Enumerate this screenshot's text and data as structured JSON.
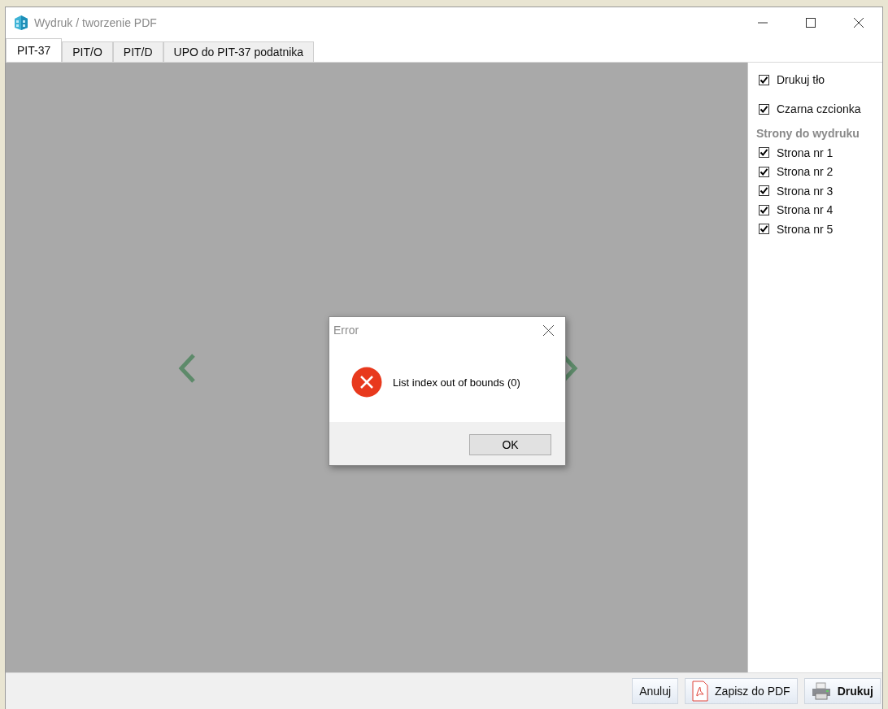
{
  "window": {
    "title": "Wydruk / tworzenie PDF"
  },
  "tabs": [
    {
      "label": "PIT-37",
      "selected": true
    },
    {
      "label": "PIT/O",
      "selected": false
    },
    {
      "label": "PIT/D",
      "selected": false
    },
    {
      "label": "UPO do PIT-37 podatnika",
      "selected": false
    }
  ],
  "options": [
    {
      "label": "Drukuj tło",
      "checked": true
    },
    {
      "label": "Czarna czcionka",
      "checked": true
    }
  ],
  "pages_section": {
    "heading": "Strony do wydruku",
    "pages": [
      {
        "label": "Strona nr 1",
        "checked": true
      },
      {
        "label": "Strona nr 2",
        "checked": true
      },
      {
        "label": "Strona nr 3",
        "checked": true
      },
      {
        "label": "Strona nr 4",
        "checked": true
      },
      {
        "label": "Strona nr 5",
        "checked": true
      }
    ]
  },
  "dialog": {
    "title": "Error",
    "message": "List index out of bounds (0)",
    "button": "OK"
  },
  "buttons": [
    {
      "label": "Anuluj",
      "kind": "plain",
      "bold": false
    },
    {
      "label": "Zapisz do PDF",
      "kind": "pdf",
      "bold": false
    },
    {
      "label": "Drukuj",
      "kind": "print",
      "bold": true
    }
  ]
}
